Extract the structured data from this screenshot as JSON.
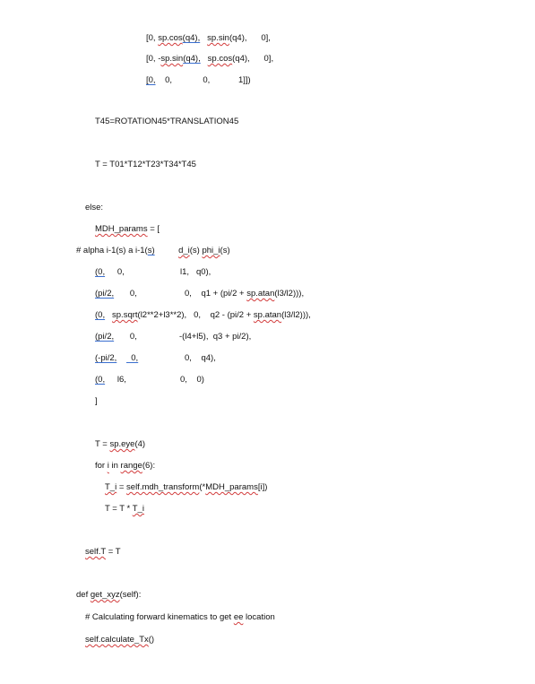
{
  "lines": [
    [
      "[0, ",
      "sp.cos",
      "(q4),",
      "   ",
      "sp.sin",
      "(q4),",
      "      0],"
    ],
    [
      "[0, -",
      "sp.sin",
      "(q4),",
      "   ",
      "sp.cos",
      "(q4),",
      "      0],"
    ],
    [
      "[0,",
      "    0,",
      "             0,",
      "            1]])"
    ],
    "T45=ROTATION45*TRANSLATION45",
    "T = T01*T12*T23*T34*T45",
    "else:",
    [
      "MDH_params",
      " = ["
    ],
    [
      "# alpha i-1(s) a i-1(",
      "s)",
      "          ",
      "d_i",
      "(s) ",
      "phi_i",
      "(s)"
    ],
    [
      "(0,",
      "   0,",
      "l1,   q0),"
    ],
    [
      "(pi/2,",
      "   0,",
      "0,    q1 + (pi/2 + ",
      "sp.atan",
      "(l3/l2))),"
    ],
    [
      "(0,",
      "   ",
      "sp.sqrt",
      "(l2**2+l3**2),   0,    q2 - (pi/2 + ",
      "sp.atan",
      "(l3/l2))),"
    ],
    [
      "(pi/2,",
      "   0,",
      "-(l4+l5),  q3 + pi/2),"
    ],
    [
      "(-pi/2,",
      "  0,",
      "0,    q4),"
    ],
    [
      "(0,",
      "   l6,",
      "0,    0)"
    ],
    "]",
    [
      "T = ",
      "sp.eye",
      "(4)"
    ],
    [
      "for ",
      "i",
      " in ",
      "range",
      "(6):"
    ],
    [
      "T_i",
      " = ",
      "self.mdh_transform",
      "(*",
      "MDH_params",
      "[i])"
    ],
    [
      "T = T * ",
      "T_i"
    ],
    [
      "self.T",
      " = T"
    ],
    [
      "def ",
      "get_xyz",
      "(self):"
    ],
    [
      "# Calculating forward kinematics to get ",
      "ee",
      " location"
    ],
    [
      "self.calculate_Tx",
      "()"
    ]
  ]
}
